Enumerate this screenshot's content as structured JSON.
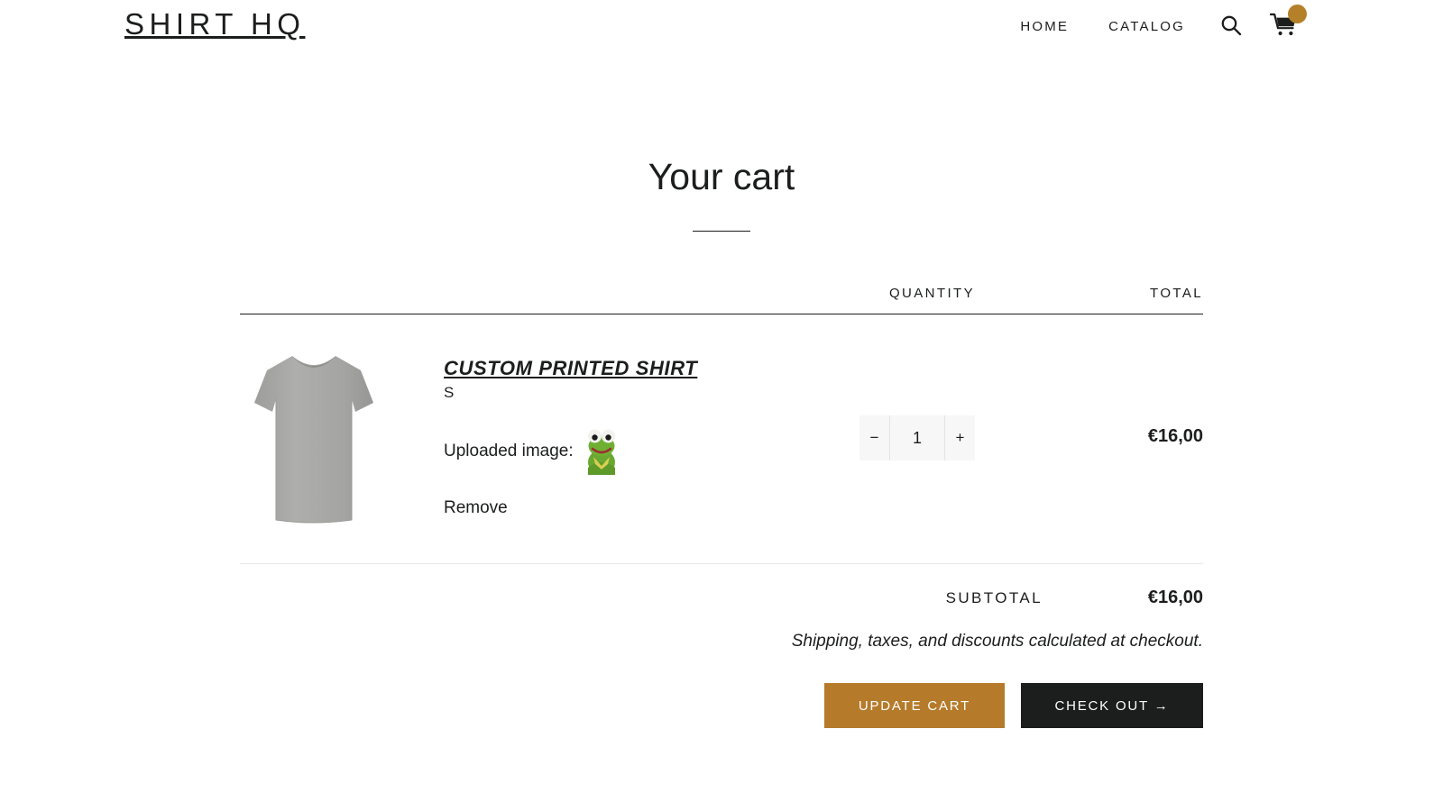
{
  "header": {
    "logo": "SHIRT HQ",
    "nav": [
      {
        "label": "HOME",
        "name": "nav-link-home"
      },
      {
        "label": "CATALOG",
        "name": "nav-link-catalog"
      }
    ],
    "search_icon": "search-icon",
    "cart_icon": "cart-icon",
    "cart_badge_color": "#b5802a"
  },
  "page": {
    "title": "Your cart"
  },
  "table": {
    "headers": {
      "quantity": "QUANTITY",
      "total": "TOTAL"
    }
  },
  "item": {
    "title": "CUSTOM PRINTED SHIRT",
    "variant": "S",
    "uploaded_label": "Uploaded image:",
    "uploaded_thumb_icon": "kermit-frog-thumbnail",
    "remove_label": "Remove",
    "quantity": "1",
    "minus_label": "−",
    "plus_label": "+",
    "line_total": "€16,00",
    "product_image_icon": "gray-tshirt-photo"
  },
  "totals": {
    "subtotal_label": "SUBTOTAL",
    "subtotal_value": "€16,00",
    "tax_note": "Shipping, taxes, and discounts calculated at checkout."
  },
  "actions": {
    "update_label": "UPDATE CART",
    "checkout_label": "CHECK OUT →",
    "update_color": "#b57b2b",
    "checkout_color": "#1c1d1d"
  }
}
